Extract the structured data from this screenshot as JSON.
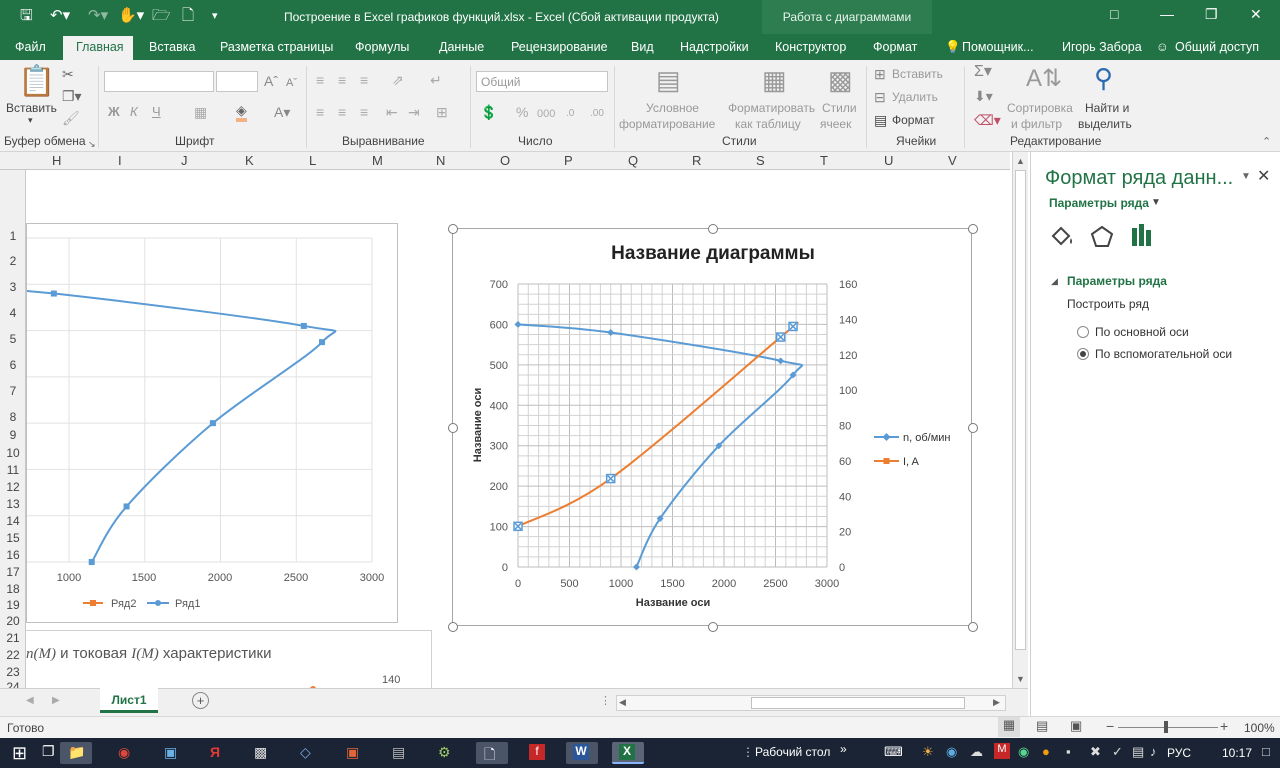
{
  "window": {
    "title": "Построение в Excel графиков функций.xlsx - Excel (Сбой активации продукта)",
    "context_tab_group": "Работа с диаграммами"
  },
  "menu": {
    "file": "Файл",
    "tabs": [
      "Главная",
      "Вставка",
      "Разметка страницы",
      "Формулы",
      "Данные",
      "Рецензирование",
      "Вид",
      "Надстройки",
      "Конструктор",
      "Формат"
    ],
    "tell_me": "Помощник...",
    "user": "Игорь Забора",
    "share": "Общий доступ"
  },
  "ribbon": {
    "clipboard": {
      "paste": "Вставить",
      "group": "Буфер обмена"
    },
    "font": {
      "bold": "Ж",
      "italic": "К",
      "underline": "Ч",
      "group": "Шрифт"
    },
    "alignment": {
      "group": "Выравнивание"
    },
    "number": {
      "format": "Общий",
      "group": "Число"
    },
    "styles": {
      "conditional_1": "Условное",
      "conditional_2": "форматирование",
      "as_table_1": "Форматировать",
      "as_table_2": "как таблицу",
      "cell_styles_1": "Стили",
      "cell_styles_2": "ячеек",
      "group": "Стили"
    },
    "cells": {
      "insert": "Вставить",
      "delete": "Удалить",
      "format": "Формат",
      "group": "Ячейки"
    },
    "editing": {
      "sort_1": "Сортировка",
      "sort_2": "и фильтр",
      "find_1": "Найти и",
      "find_2": "выделить",
      "group": "Редактирование"
    }
  },
  "columns": [
    "H",
    "I",
    "J",
    "K",
    "L",
    "M",
    "N",
    "O",
    "P",
    "Q",
    "R",
    "S",
    "T",
    "U",
    "V"
  ],
  "rows": [
    "1",
    "2",
    "3",
    "4",
    "5",
    "6",
    "7",
    "8",
    "9",
    "10",
    "11",
    "12",
    "13",
    "14",
    "15",
    "16",
    "17",
    "18",
    "19",
    "20",
    "21",
    "22",
    "23",
    "24"
  ],
  "left_chart": {
    "x_ticks": [
      "1000",
      "1500",
      "2000",
      "2500",
      "3000"
    ],
    "legend": [
      "Ряд2",
      "Ряд1"
    ],
    "colors": {
      "series1": "#5b9bd5",
      "series2": "#ed7d31"
    }
  },
  "caption": {
    "part1": "n",
    "part2": "(M)",
    "part3": " и токовая ",
    "part4": "I",
    "part5": "(M)",
    "part6": " характеристики",
    "tick": "140"
  },
  "chart_data": {
    "type": "scatter",
    "title": "Название диаграммы",
    "xlabel": "Название оси",
    "ylabel": "Название оси",
    "xlim": [
      0,
      3000
    ],
    "ylim": [
      0,
      700
    ],
    "y2lim": [
      0,
      160
    ],
    "x_ticks": [
      "0",
      "500",
      "1000",
      "1500",
      "2000",
      "2500",
      "3000"
    ],
    "y_ticks": [
      "0",
      "100",
      "200",
      "300",
      "400",
      "500",
      "600",
      "700"
    ],
    "y2_ticks": [
      "0",
      "20",
      "40",
      "60",
      "80",
      "100",
      "120",
      "140",
      "160"
    ],
    "legend_position": "right",
    "grid": true,
    "series": [
      {
        "name": "n, об/мин",
        "axis": "primary",
        "color": "#5b9bd5",
        "marker": "diamond",
        "x": [
          0,
          900,
          2550,
          2670,
          1950,
          1380,
          1150
        ],
        "y": [
          600,
          580,
          510,
          475,
          300,
          120,
          0
        ]
      },
      {
        "name": "I, A",
        "axis": "secondary",
        "color": "#ed7d31",
        "marker": "square",
        "x": [
          0,
          900,
          2550,
          2670
        ],
        "y": [
          23,
          50,
          130,
          136
        ]
      }
    ]
  },
  "sheet_tabs": {
    "active": "Лист1"
  },
  "status": {
    "ready": "Готово",
    "zoom": "100%"
  },
  "pane": {
    "title": "Формат ряда данн...",
    "subtitle": "Параметры ряда",
    "section": "Параметры ряда",
    "build_on": "Построить ряд",
    "option_primary": "По основной оси",
    "option_secondary": "По вспомогательной оси",
    "selected": "secondary"
  },
  "taskbar": {
    "desktop": "Рабочий стол",
    "lang": "РУС",
    "time": "10:17"
  }
}
